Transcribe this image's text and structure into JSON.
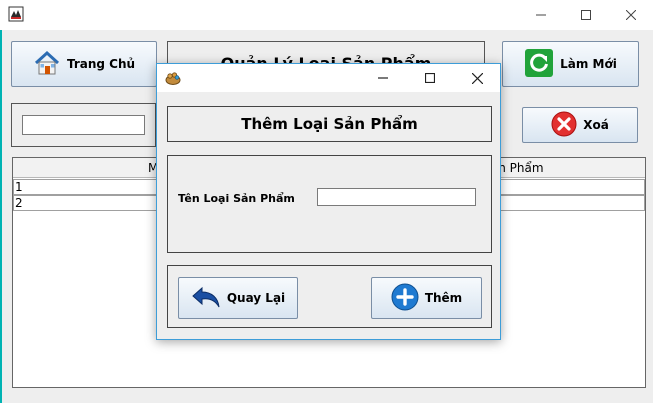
{
  "main_window": {
    "window_controls": {
      "minimize": "minimize",
      "maximize": "maximize",
      "close": "close"
    },
    "header": {
      "home_label": "Trang Chủ",
      "title": "Quản Lý Loại Sản Phẩm",
      "refresh_label": "Làm Mới"
    },
    "toolbar": {
      "search_value": "",
      "delete_label": "Xoá"
    },
    "table": {
      "columns": [
        "Mã Loại",
        "Tên Loại Sản Phẩm"
      ],
      "rows": [
        [
          "1",
          ""
        ],
        [
          "2",
          ""
        ]
      ]
    }
  },
  "dialog": {
    "heading": "Thêm Loại Sản Phẩm",
    "form": {
      "name_label": "Tên Loại Sản Phẩm",
      "name_value": ""
    },
    "actions": {
      "back_label": "Quay Lại",
      "add_label": "Thêm"
    }
  },
  "colors": {
    "window_accent": "#00b3b3",
    "dialog_border": "#3d9dd8",
    "button_gradient_top": "#f7fafd",
    "button_gradient_bottom": "#d9e5f1",
    "delete_red": "#e23030",
    "refresh_green": "#21a33a",
    "add_blue": "#1f7ad1"
  },
  "icons": [
    "app-icon",
    "home-icon",
    "refresh-icon",
    "delete-icon",
    "back-arrow-icon",
    "plus-icon",
    "dialog-app-icon"
  ]
}
